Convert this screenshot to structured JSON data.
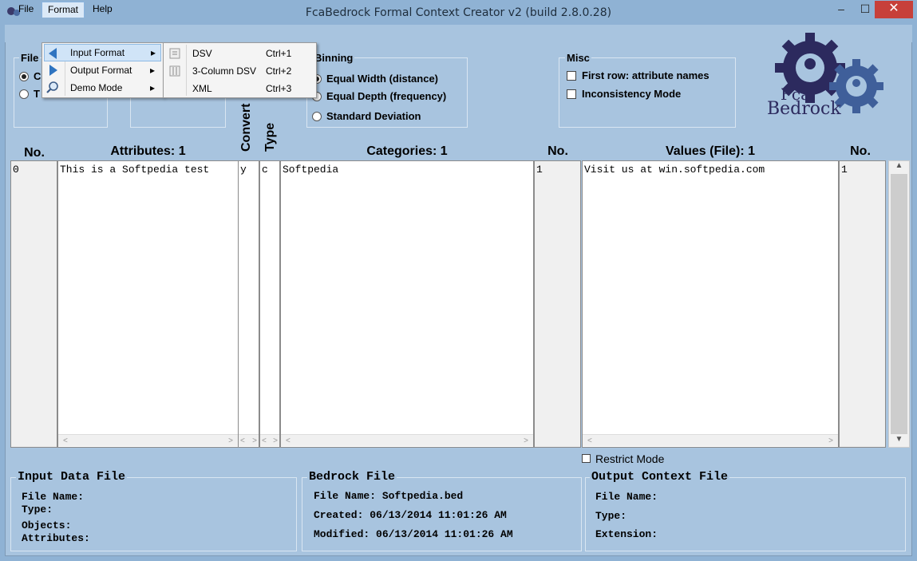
{
  "window": {
    "title": "FcaBedrock Formal Context Creator v2 (build 2.8.0.28)",
    "min_glyph": "–",
    "max_glyph": "☐",
    "close_glyph": "✕"
  },
  "menubar": {
    "file": "File",
    "format": "Format",
    "help": "Help"
  },
  "format_menu": {
    "items": [
      {
        "label": "Input Format",
        "arrow": "▸"
      },
      {
        "label": "Output Format",
        "arrow": "▸"
      },
      {
        "label": "Demo Mode",
        "arrow": "▸"
      }
    ]
  },
  "input_format_submenu": {
    "items": [
      {
        "label": "DSV",
        "shortcut": "Ctrl+1"
      },
      {
        "label": "3-Column DSV",
        "shortcut": "Ctrl+2"
      },
      {
        "label": "XML",
        "shortcut": "Ctrl+3"
      }
    ]
  },
  "file_group": {
    "label": "File",
    "opt1": "C",
    "opt2": "T"
  },
  "binning": {
    "label": "Binning",
    "options": [
      "Equal Width (distance)",
      "Equal Depth (frequency)",
      "Standard Deviation"
    ]
  },
  "misc": {
    "label": "Misc",
    "options": [
      "First row: attribute names",
      "Inconsistency Mode"
    ]
  },
  "logo": {
    "line1": "Fca",
    "line2": "Bedrock"
  },
  "columns": {
    "no1": "No.",
    "attributes": "Attributes: 1",
    "convert": "Convert",
    "type": "Type",
    "categories": "Categories: 1",
    "no2": "No.",
    "values": "Values (File): 1",
    "no3": "No."
  },
  "rows": {
    "no1": "0",
    "attribute": "This is a Softpedia test",
    "convert": "y",
    "type": "c",
    "category": "Softpedia",
    "no2": "1",
    "value": "Visit us at win.softpedia.com",
    "no3": "1"
  },
  "restrict_mode": "Restrict Mode",
  "input_data_file": {
    "label": "Input Data File",
    "fields": [
      "File Name:",
      "Type:",
      "Objects:",
      "Attributes:"
    ]
  },
  "bedrock_file": {
    "label": "Bedrock File",
    "file_name": "File Name: Softpedia.bed",
    "created": "Created: 06/13/2014 11:01:26 AM",
    "modified": "Modified: 06/13/2014 11:01:26 AM"
  },
  "output_context_file": {
    "label": "Output Context File",
    "fields": [
      "File Name:",
      "Type:",
      "Extension:"
    ]
  },
  "colors": {
    "background": "#a8c4df",
    "titlebar": "#8fb2d4",
    "close": "#c7403a",
    "logo": "#2c2a5e"
  }
}
